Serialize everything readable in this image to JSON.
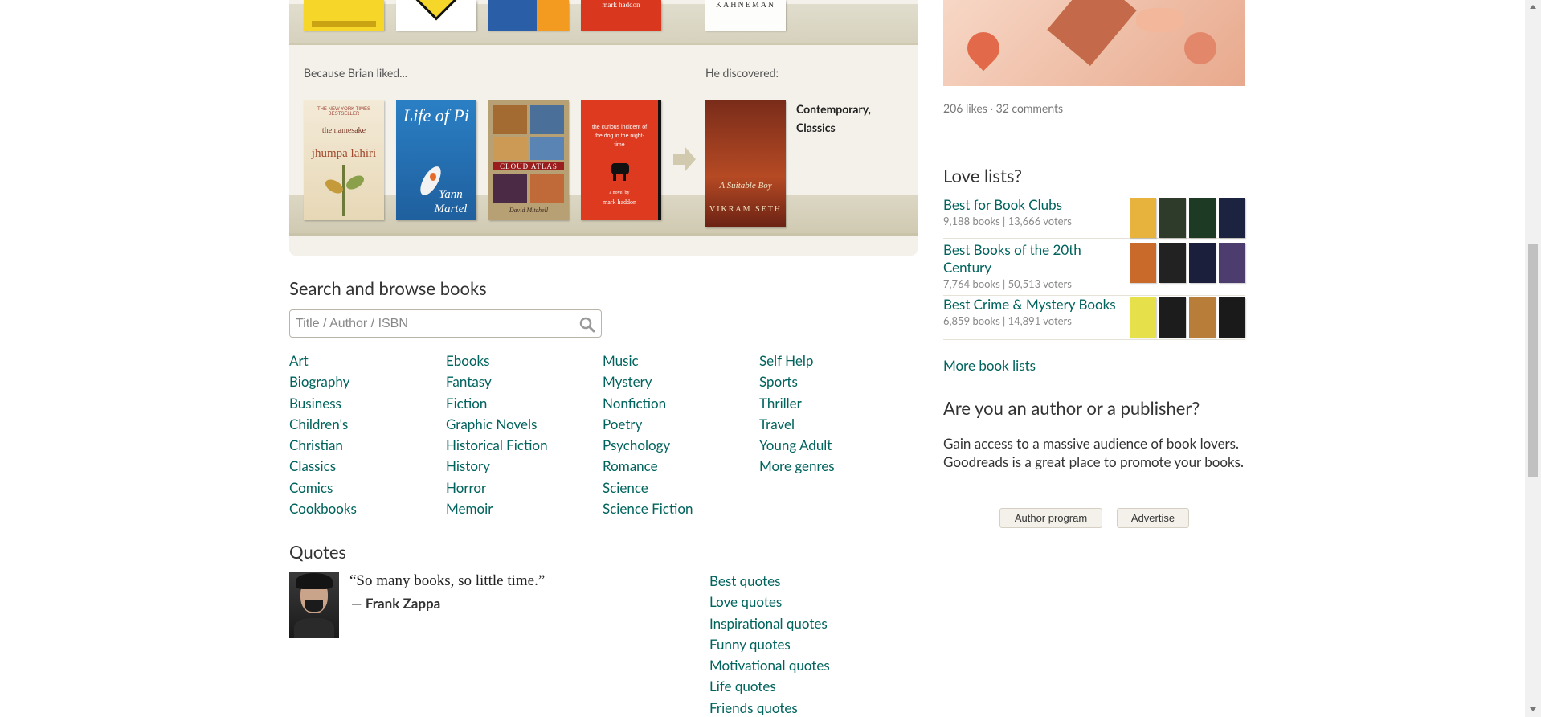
{
  "recommendation": {
    "because_label": "Because Brian liked...",
    "discovered_label": "He discovered:",
    "genres": "Contemporary, Classics",
    "top_row_author_fragment": "KAHNEMAN",
    "top_row_haddon": "mark haddon",
    "liked_books": [
      {
        "name": "the-namesake-cover",
        "top_text": "THE NEW YORK TIMES BESTSELLER",
        "title": "the namesake",
        "author": "jhumpa lahiri"
      },
      {
        "name": "life-of-pi-cover",
        "title": "Life of Pi",
        "author": "Yann Martel"
      },
      {
        "name": "cloud-atlas-cover",
        "title": "CLOUD ATLAS",
        "author": "David Mitchell"
      },
      {
        "name": "curious-incident-cover",
        "title": "the curious incident of the dog in the night-time",
        "subtitle": "a novel by",
        "author": "mark haddon"
      }
    ],
    "discovered_book": {
      "title": "A Suitable Boy",
      "author": "VIKRAM SETH"
    }
  },
  "search": {
    "title": "Search and browse books",
    "placeholder": "Title / Author / ISBN",
    "icon": "magnifier-icon"
  },
  "genres": [
    [
      "Art",
      "Biography",
      "Business",
      "Children's",
      "Christian",
      "Classics",
      "Comics",
      "Cookbooks"
    ],
    [
      "Ebooks",
      "Fantasy",
      "Fiction",
      "Graphic Novels",
      "Historical Fiction",
      "History",
      "Horror",
      "Memoir"
    ],
    [
      "Music",
      "Mystery",
      "Nonfiction",
      "Poetry",
      "Psychology",
      "Romance",
      "Science",
      "Science Fiction"
    ],
    [
      "Self Help",
      "Sports",
      "Thriller",
      "Travel",
      "Young Adult",
      "More genres"
    ]
  ],
  "quotes": {
    "title": "Quotes",
    "text": "“So many books, so little time.”",
    "dash": "—",
    "author": "Frank Zappa",
    "links": [
      "Best quotes",
      "Love quotes",
      "Inspirational quotes",
      "Funny quotes",
      "Motivational quotes",
      "Life quotes",
      "Friends quotes"
    ]
  },
  "sidebar": {
    "likes": "206 likes · 32 comments",
    "lists_title": "Love lists?",
    "lists": [
      {
        "title": "Best for Book Clubs",
        "meta": "9,188 books | 13,666 voters",
        "covers": [
          "#e8b33c",
          "#2e3a2a",
          "#1d3b24",
          "#1b2340"
        ]
      },
      {
        "title": "Best Books of the 20th Century",
        "meta": "7,764 books | 50,513 voters",
        "covers": [
          "#c96a2a",
          "#222222",
          "#1c1f3b",
          "#4c3d6e"
        ]
      },
      {
        "title": "Best Crime & Mystery Books",
        "meta": "6,859 books | 14,891 voters",
        "covers": [
          "#e6e04a",
          "#1c1c1c",
          "#b87d38",
          "#1a1a1a"
        ]
      }
    ],
    "more_lists": "More book lists",
    "author_title": "Are you an author or a publisher?",
    "author_text": "Gain access to a massive audience of book lovers. Goodreads is a great place to promote your books.",
    "author_program": "Author program",
    "advertise": "Advertise"
  },
  "colors": {
    "link": "#00635d",
    "panel_bg": "#f4f1ea",
    "button_bg": "#f4f1ea"
  }
}
